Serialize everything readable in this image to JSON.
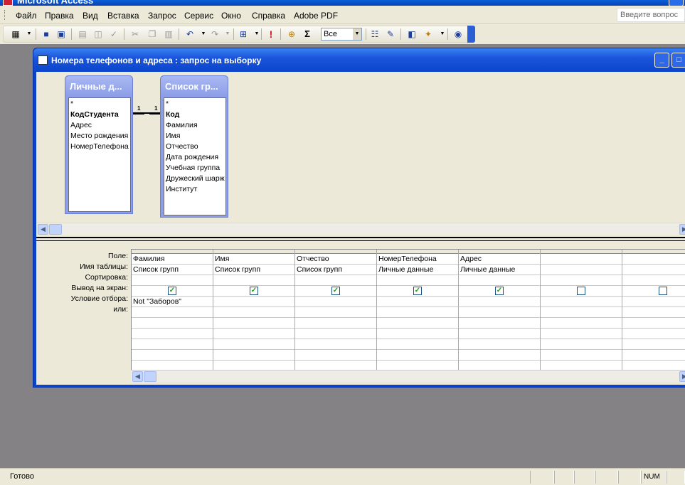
{
  "app": {
    "title": "Microsoft Access"
  },
  "menu": {
    "items": [
      "Файл",
      "Правка",
      "Вид",
      "Вставка",
      "Запрос",
      "Сервис",
      "Окно",
      "Справка",
      "Adobe PDF"
    ],
    "help_placeholder": "Введите вопрос"
  },
  "toolbar": {
    "top_values": "Все",
    "sigma": "Σ",
    "run": "!"
  },
  "window": {
    "title": "Номера телефонов и адреса : запрос на выборку",
    "minimize": "_",
    "maximize": "□"
  },
  "tables": [
    {
      "title": "Личные д...",
      "fields": [
        "*",
        "КодСтудента",
        "Адрес",
        "Место рождения",
        "НомерТелефона"
      ],
      "key_field": "КодСтудента"
    },
    {
      "title": "Список гр...",
      "fields": [
        "*",
        "Код",
        "Фамилия",
        "Имя",
        "Отчество",
        "Дата рождения",
        "Учебная группа",
        "Дружеский шарж",
        "Институт"
      ],
      "key_field": "Код"
    }
  ],
  "relationship": {
    "left": "1",
    "right": "1"
  },
  "qbe": {
    "labels": [
      "Поле:",
      "Имя таблицы:",
      "Сортировка:",
      "Вывод на экран:",
      "Условие отбора:",
      "или:"
    ],
    "columns": [
      {
        "field": "Фамилия",
        "table": "Список групп",
        "sort": "",
        "show": true,
        "criteria": "Not \"Заборов\""
      },
      {
        "field": "Имя",
        "table": "Список групп",
        "sort": "",
        "show": true,
        "criteria": ""
      },
      {
        "field": "Отчество",
        "table": "Список групп",
        "sort": "",
        "show": true,
        "criteria": ""
      },
      {
        "field": "НомерТелефона",
        "table": "Личные данные",
        "sort": "",
        "show": true,
        "criteria": ""
      },
      {
        "field": "Адрес",
        "table": "Личные данные",
        "sort": "",
        "show": true,
        "criteria": ""
      },
      {
        "field": "",
        "table": "",
        "sort": "",
        "show": false,
        "criteria": ""
      },
      {
        "field": "",
        "table": "",
        "sort": "",
        "show": false,
        "criteria": ""
      }
    ]
  },
  "status": {
    "text": "Готово",
    "num": "NUM"
  }
}
